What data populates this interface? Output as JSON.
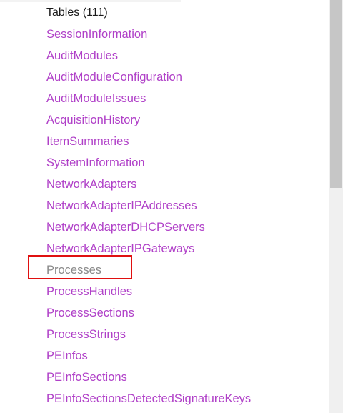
{
  "header": {
    "title": "Tables (111)"
  },
  "tables": [
    {
      "label": "SessionInformation",
      "visited": false
    },
    {
      "label": "AuditModules",
      "visited": false
    },
    {
      "label": "AuditModuleConfiguration",
      "visited": false
    },
    {
      "label": "AuditModuleIssues",
      "visited": false
    },
    {
      "label": "AcquisitionHistory",
      "visited": false
    },
    {
      "label": "ItemSummaries",
      "visited": false
    },
    {
      "label": "SystemInformation",
      "visited": false
    },
    {
      "label": "NetworkAdapters",
      "visited": false
    },
    {
      "label": "NetworkAdapterIPAddresses",
      "visited": false
    },
    {
      "label": "NetworkAdapterDHCPServers",
      "visited": false
    },
    {
      "label": "NetworkAdapterIPGateways",
      "visited": false
    },
    {
      "label": "Processes",
      "visited": true
    },
    {
      "label": "ProcessHandles",
      "visited": false
    },
    {
      "label": "ProcessSections",
      "visited": false
    },
    {
      "label": "ProcessStrings",
      "visited": false
    },
    {
      "label": "PEInfos",
      "visited": false
    },
    {
      "label": "PEInfoSections",
      "visited": false
    },
    {
      "label": "PEInfoSectionsDetectedSignatureKeys",
      "visited": false
    }
  ],
  "colors": {
    "link": "#b040c8",
    "visited_link": "#8a8a8a",
    "highlight_border": "#e01010"
  }
}
